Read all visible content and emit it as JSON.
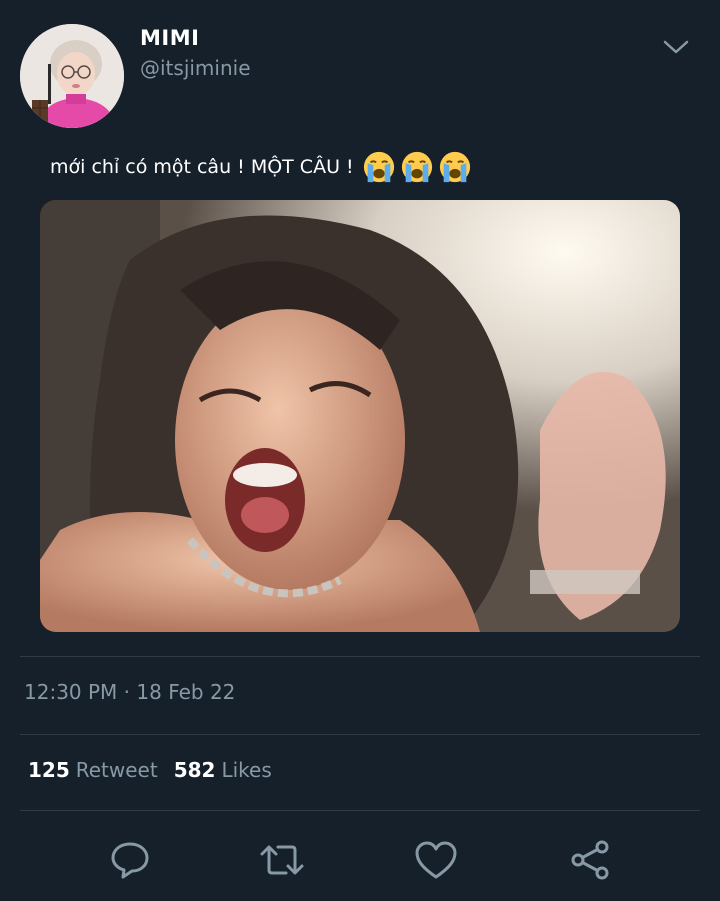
{
  "author": {
    "display_name": "MIMI",
    "handle": "@itsjiminie"
  },
  "tweet": {
    "text": "mới chỉ có một câu ! MỘT CÂU !",
    "emojis": [
      "loudly-crying-face",
      "loudly-crying-face",
      "loudly-crying-face"
    ],
    "timestamp": "12:30 PM · 18 Feb 22"
  },
  "stats": {
    "retweets": {
      "count": "125",
      "label": "Retweet"
    },
    "likes": {
      "count": "582",
      "label": "Likes"
    }
  },
  "actions": [
    "reply-icon",
    "retweet-icon",
    "like-icon",
    "share-icon"
  ],
  "colors": {
    "background": "#15202b",
    "secondary_text": "#8899a6",
    "divider": "#2f3b47"
  }
}
